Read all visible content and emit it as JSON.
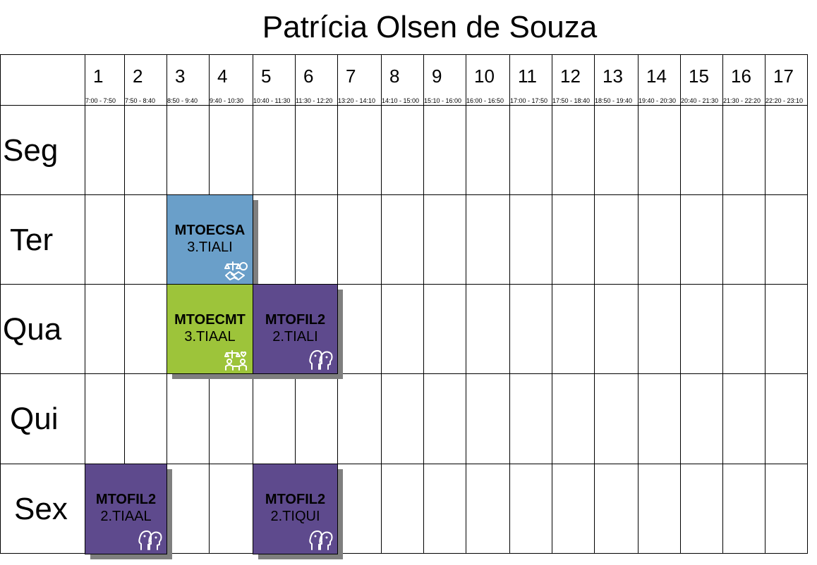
{
  "title": "Patrícia Olsen de Souza",
  "periods": [
    {
      "num": "1",
      "time": "7:00 - 7:50"
    },
    {
      "num": "2",
      "time": "7:50 - 8:40"
    },
    {
      "num": "3",
      "time": "8:50 - 9:40"
    },
    {
      "num": "4",
      "time": "9:40 - 10:30"
    },
    {
      "num": "5",
      "time": "10:40 - 11:30"
    },
    {
      "num": "6",
      "time": "11:30 - 12:20"
    },
    {
      "num": "7",
      "time": "13:20 - 14:10"
    },
    {
      "num": "8",
      "time": "14:10 - 15:00"
    },
    {
      "num": "9",
      "time": "15:10 - 16:00"
    },
    {
      "num": "10",
      "time": "16:00 - 16:50"
    },
    {
      "num": "11",
      "time": "17:00 - 17:50"
    },
    {
      "num": "12",
      "time": "17:50 - 18:40"
    },
    {
      "num": "13",
      "time": "18:50 - 19:40"
    },
    {
      "num": "14",
      "time": "19:40 - 20:30"
    },
    {
      "num": "15",
      "time": "20:40 - 21:30"
    },
    {
      "num": "16",
      "time": "21:30 - 22:20"
    },
    {
      "num": "17",
      "time": "22:20 - 23:10"
    }
  ],
  "days": [
    "Seg",
    "Ter",
    "Qua",
    "Qui",
    "Sex"
  ],
  "classes": [
    {
      "day": "Ter",
      "periods": [
        3,
        4
      ],
      "code": "MTOECSA",
      "group": "3.TIALI",
      "color": "#6a9fc9",
      "icon": "scales-handshake-icon"
    },
    {
      "day": "Qua",
      "periods": [
        3,
        4
      ],
      "code": "MTOECMT",
      "group": "3.TIAAL",
      "color": "#9dc43a",
      "icon": "scales-people-icon"
    },
    {
      "day": "Qua",
      "periods": [
        5,
        6
      ],
      "code": "MTOFIL2",
      "group": "2.TIALI",
      "color": "#5e4a8d",
      "icon": "philosophy-heads-icon"
    },
    {
      "day": "Sex",
      "periods": [
        1,
        2
      ],
      "code": "MTOFIL2",
      "group": "2.TIAAL",
      "color": "#5e4a8d",
      "icon": "philosophy-heads-icon"
    },
    {
      "day": "Sex",
      "periods": [
        5,
        6
      ],
      "code": "MTOFIL2",
      "group": "2.TIQUI",
      "color": "#5e4a8d",
      "icon": "philosophy-heads-icon"
    }
  ]
}
